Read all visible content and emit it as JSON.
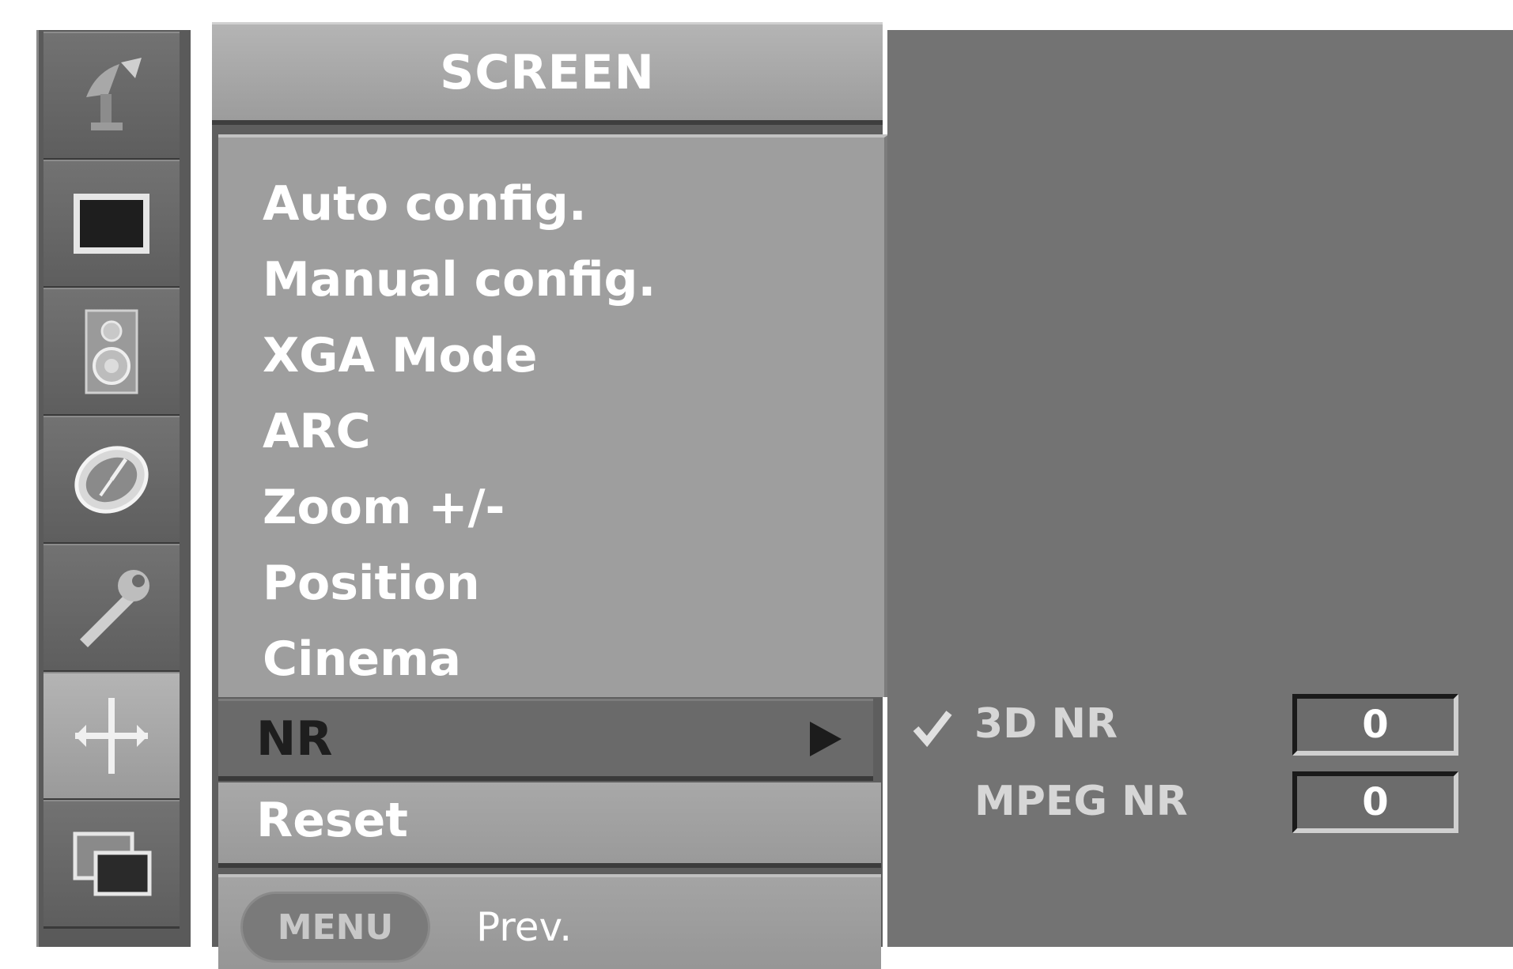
{
  "menu": {
    "title": "SCREEN",
    "items": [
      {
        "label": "Auto config."
      },
      {
        "label": "Manual config."
      },
      {
        "label": "XGA Mode"
      },
      {
        "label": "ARC"
      },
      {
        "label": "Zoom +/-"
      },
      {
        "label": "Position"
      },
      {
        "label": "Cinema"
      },
      {
        "label": "NR",
        "selected": true
      },
      {
        "label": "Reset"
      }
    ]
  },
  "submenu": {
    "items": [
      {
        "label": "3D NR",
        "value": "0",
        "checked": true
      },
      {
        "label": "MPEG NR",
        "value": "0",
        "checked": false
      }
    ]
  },
  "footer": {
    "key_label": "MENU",
    "action_label": "Prev."
  },
  "sidebar": {
    "icons": [
      {
        "name": "satellite-dish-icon"
      },
      {
        "name": "picture-icon"
      },
      {
        "name": "speaker-icon"
      },
      {
        "name": "clock-icon"
      },
      {
        "name": "wrench-icon"
      },
      {
        "name": "screen-adjust-icon",
        "active": true
      },
      {
        "name": "pip-icon"
      }
    ]
  }
}
